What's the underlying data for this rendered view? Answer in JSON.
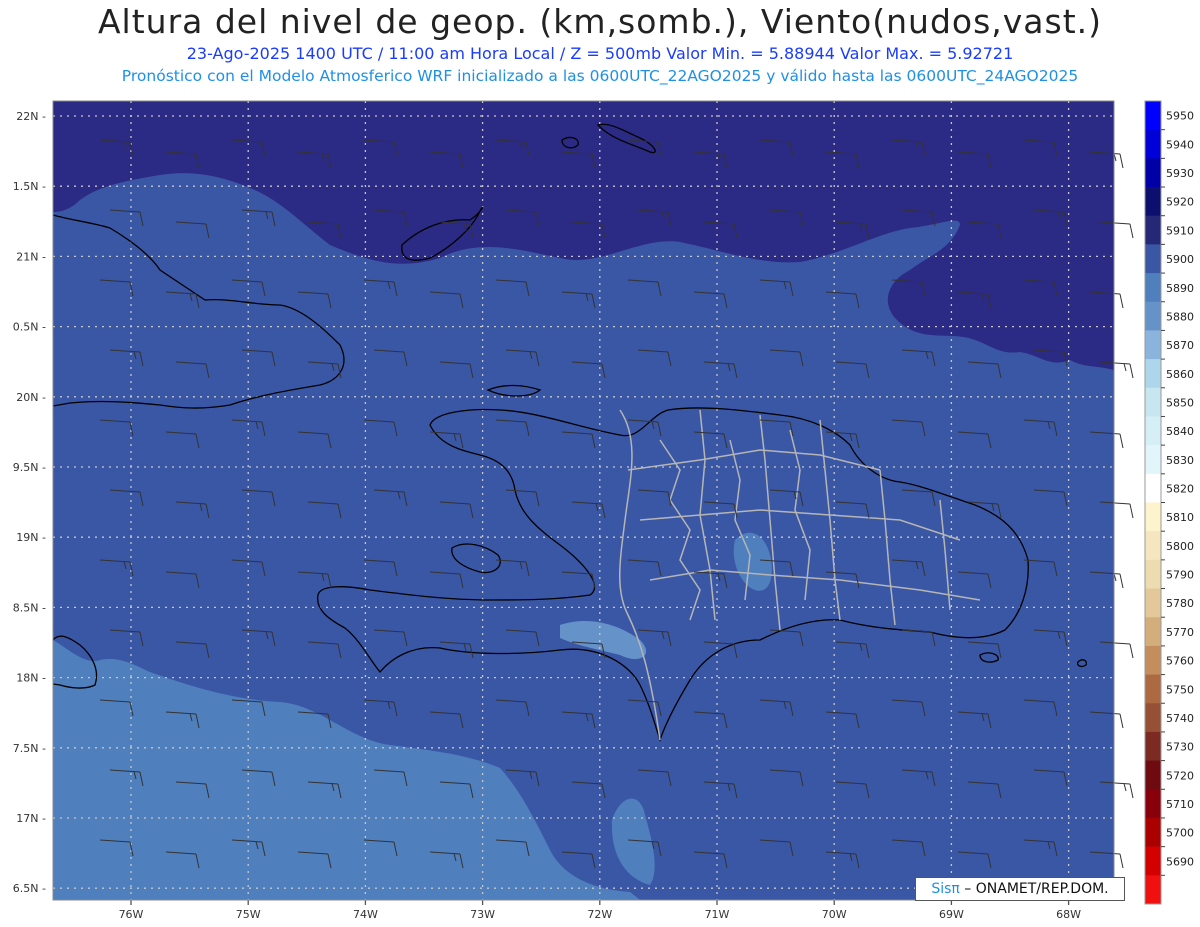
{
  "title": "Altura del nivel de geop. (km,somb.), Viento(nudos,vast.)",
  "subtitle1": "23-Ago-2025  1400 UTC / 11:00 am Hora Local / Z = 500mb    Valor Min. = 5.88944  Valor Max. = 5.92721",
  "subtitle2": "Pronóstico con el Modelo Atmosferico WRF inicializado a las 0600UTC_22AGO2025 y válido hasta las  0600UTC_24AGO2025",
  "credit": {
    "brand": "Sisπ",
    "text": " – ONAMET/REP.DOM."
  },
  "colors": {
    "field_main": "#3a57a6",
    "field_high": "#2b2a85",
    "field_low": "#4f7fbd",
    "field_lowest": "#6592c8",
    "coast": "#000000",
    "province_border": "#b5b5b5",
    "grid": "#c8c8c8"
  },
  "axes": {
    "lat_labels": [
      "22N",
      "1.5N",
      "21N",
      "0.5N",
      "20N",
      "9.5N",
      "19N",
      "8.5N",
      "18N",
      "7.5N",
      "17N",
      "6.5N"
    ],
    "lon_labels": [
      "76W",
      "75W",
      "74W",
      "73W",
      "72W",
      "71W",
      "70W",
      "69W",
      "68W"
    ]
  },
  "colorbar": {
    "labels": [
      "5950",
      "5940",
      "5930",
      "5920",
      "5910",
      "5900",
      "5890",
      "5880",
      "5870",
      "5860",
      "5850",
      "5840",
      "5830",
      "5820",
      "5810",
      "5800",
      "5790",
      "5780",
      "5770",
      "5760",
      "5750",
      "5740",
      "5730",
      "5720",
      "5710",
      "5700",
      "5690"
    ],
    "colors": [
      "#0000ff",
      "#0000d8",
      "#0000a6",
      "#0d0f6e",
      "#252777",
      "#3a57a6",
      "#4f7fbd",
      "#6592c8",
      "#8ab4dc",
      "#aed6ea",
      "#c7e6f0",
      "#d6eef6",
      "#e2f5fa",
      "#ffffff",
      "#fdf3cc",
      "#f6e6c0",
      "#eddcb0",
      "#e3c99a",
      "#d4ad7c",
      "#c38d5e",
      "#ad6a42",
      "#965035",
      "#7c2a22",
      "#6e0a10",
      "#88000c",
      "#ab0000",
      "#d40000",
      "#f01010"
    ]
  }
}
